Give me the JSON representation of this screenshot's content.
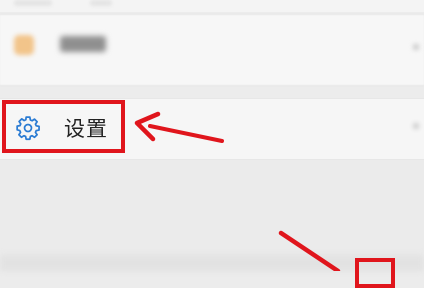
{
  "settings_item": {
    "label": "设置",
    "icon": "gear-icon"
  },
  "colors": {
    "annotation": "#e0151c",
    "icon": "#2a7bd3"
  }
}
